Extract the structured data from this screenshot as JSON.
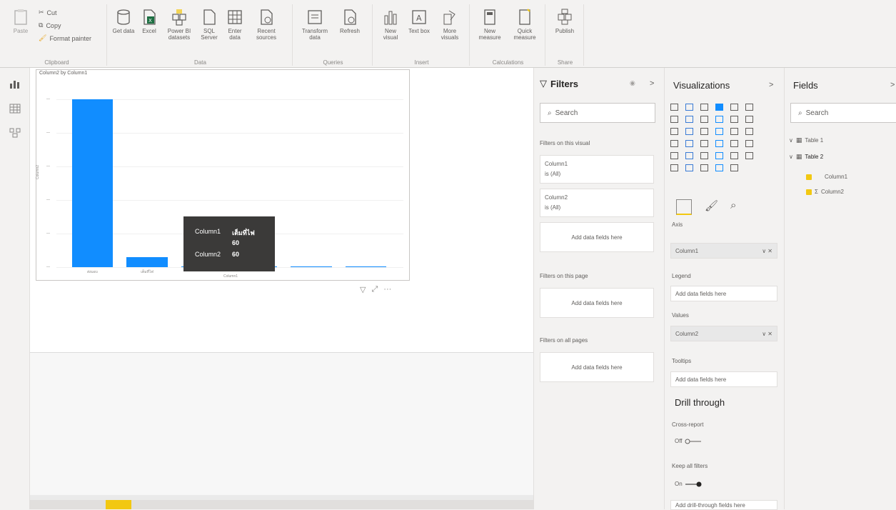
{
  "ribbon": {
    "clipboard": {
      "paste": "Paste",
      "cut": "Cut",
      "copy": "Copy",
      "format_painter": "Format painter",
      "group_label": "Clipboard"
    },
    "data": {
      "get_data": "Get data",
      "excel": "Excel",
      "power_bi_datasets": "Power BI datasets",
      "sql_server": "SQL Server",
      "enter_data": "Enter data",
      "recent_sources": "Recent sources",
      "group_label": "Data"
    },
    "queries": {
      "transform_data": "Transform data",
      "refresh": "Refresh",
      "group_label": "Queries"
    },
    "insert": {
      "new_visual": "New visual",
      "text_box": "Text box",
      "more_visuals": "More visuals",
      "group_label": "Insert"
    },
    "calculations": {
      "new_measure": "New measure",
      "quick_measure": "Quick measure",
      "group_label": "Calculations"
    },
    "share": {
      "publish": "Publish",
      "group_label": "Share"
    }
  },
  "visual": {
    "title": "Column2 by Column1",
    "x_axis_title": "Column1",
    "y_axis_title": "Column2",
    "accent": "#118dff"
  },
  "chart_data": {
    "type": "bar",
    "title": "Column2 by Column1",
    "xlabel": "Column1",
    "ylabel": "Column2",
    "categories": [
      "ส่งมอบ",
      "เต็มที่ไฟ",
      "",
      "",
      "",
      ""
    ],
    "values": [
      1000,
      60,
      3,
      2,
      2,
      1
    ],
    "ylim": [
      0,
      1100
    ],
    "grid": false,
    "legend": "none"
  },
  "tooltip": {
    "col1_label": "Column1",
    "col1_value": "เต็มที่ไฟ",
    "sub_value": "60",
    "col2_label": "Column2",
    "col2_value": "60"
  },
  "filters": {
    "title": "Filters",
    "search_placeholder": "Search",
    "on_visual_label": "Filters on this visual",
    "card1_name": "Column1",
    "card1_value": "is (All)",
    "card2_name": "Column2",
    "card2_value": "is (All)",
    "add_fields": "Add data fields here",
    "on_page_label": "Filters on this page",
    "on_all_pages_label": "Filters on all pages"
  },
  "visualizations": {
    "title": "Visualizations",
    "axis_label": "Axis",
    "axis_value": "Column1",
    "legend_label": "Legend",
    "add_fields": "Add data fields here",
    "values_label": "Values",
    "values_value": "Column2",
    "tooltips_label": "Tooltips",
    "drill_through": "Drill through",
    "cross_report": "Cross-report",
    "cross_report_state": "Off",
    "keep_all_filters": "Keep all filters",
    "keep_all_state": "On",
    "add_drill_fields": "Add drill-through fields here"
  },
  "fields": {
    "title": "Fields",
    "search_placeholder": "Search",
    "table1": "Table 1",
    "table2": "Table 2",
    "col1": "Column1",
    "col2": "Column2",
    "sigma": "Σ"
  },
  "glyphs": {
    "chevron_right": ">",
    "chevron_down": "∨",
    "chevron_right_small": "›",
    "remove": "∨ ✕",
    "more": "···",
    "funnel": "▽",
    "eye": "👁"
  }
}
